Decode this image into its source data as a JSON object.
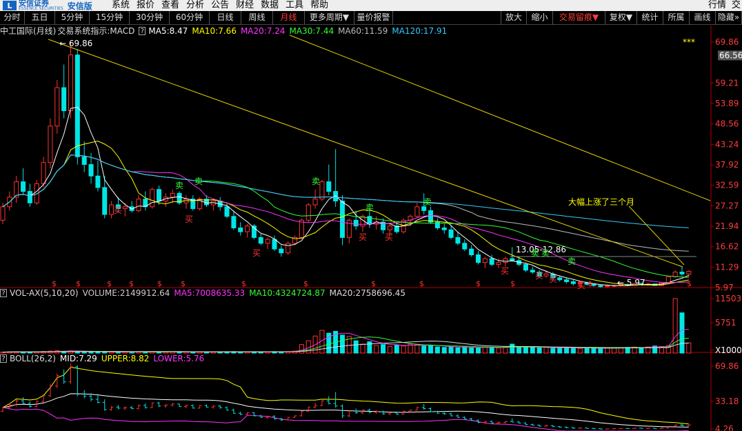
{
  "app": {
    "logo_char": "L",
    "brand_cn": "安信证券",
    "brand_en": "ESSENCE SECURITIES",
    "edition": "安信版",
    "menus": [
      "系统",
      "报价",
      "查看",
      "分析",
      "公告",
      "财经",
      "数据",
      "工具",
      "帮助"
    ],
    "right_menus": [
      "行情",
      "交"
    ]
  },
  "toolbar": {
    "left": [
      "分时",
      "五日",
      "5分钟",
      "15分钟",
      "30分钟",
      "60分钟",
      "日线",
      "周线",
      "月线",
      "更多周期▼",
      "量价报警"
    ],
    "active": "月线",
    "right": [
      "放大",
      "缩小",
      "交易留痕▼",
      "复权▼",
      "统计",
      "所属",
      "画线",
      "隐藏»"
    ],
    "right_active": "交易留痕▼"
  },
  "main_panel": {
    "title": "中工国际(月线)",
    "system": "交易系统指示:MACD",
    "ma": [
      {
        "label": "MA5:8.47",
        "color": "#ffffff"
      },
      {
        "label": "MA10:7.66",
        "color": "#ffff00"
      },
      {
        "label": "MA20:7.24",
        "color": "#ff33ff"
      },
      {
        "label": "MA30:7.44",
        "color": "#33ff33"
      },
      {
        "label": "MA60:11.59",
        "color": "#bbbbbb"
      },
      {
        "label": "MA120:17.91",
        "color": "#33ccff"
      }
    ],
    "y_ticks": [
      "69.86",
      "59.21",
      "53.89",
      "48.56",
      "43.24",
      "37.92",
      "32.59",
      "27.27",
      "21.94",
      "16.62",
      "11.29",
      "5.97"
    ],
    "current_price": "66.56",
    "high_label": "69.86",
    "low_label": "5.97",
    "range_label": "13.05-12.86",
    "annotation": "大幅上涨了三个月",
    "stars": "***",
    "buy_label": "买",
    "sell_label": "卖",
    "dollar_label": "$"
  },
  "volume_panel": {
    "title": "VOL-AX(5,10,20)",
    "volume": {
      "label": "VOLUME:2149912.64",
      "color": "#ffff00"
    },
    "ma": [
      {
        "label": "MA5:7008635.33",
        "color": "#ff33ff"
      },
      {
        "label": "MA10:4324724.87",
        "color": "#33ff33"
      },
      {
        "label": "MA20:2758696.45",
        "color": "#dddddd"
      }
    ],
    "y_ticks": [
      "11503",
      "5751",
      "X1000"
    ]
  },
  "boll_panel": {
    "title": "BOLL(26,2)",
    "items": [
      {
        "label": "MID:7.29",
        "color": "#ffffff"
      },
      {
        "label": "UPPER:8.82",
        "color": "#ffff00"
      },
      {
        "label": "LOWER:5.76",
        "color": "#ff33ff"
      }
    ],
    "y_ticks": [
      "69.86",
      "33.18",
      "4.26"
    ]
  },
  "chart_data": {
    "type": "candlestick",
    "period": "monthly",
    "candles": [
      [
        23.5,
        28.0,
        22.5,
        27.0
      ],
      [
        27.0,
        31.0,
        26.0,
        29.5
      ],
      [
        29.5,
        35.0,
        28.0,
        33.5
      ],
      [
        33.5,
        37.0,
        30.0,
        31.0
      ],
      [
        31.0,
        33.0,
        27.0,
        28.0
      ],
      [
        28.0,
        34.0,
        27.5,
        33.0
      ],
      [
        33.0,
        40.0,
        32.0,
        38.5
      ],
      [
        38.5,
        50.0,
        37.0,
        48.0
      ],
      [
        48.0,
        60.0,
        46.0,
        58.0
      ],
      [
        58.0,
        64.0,
        50.0,
        52.0
      ],
      [
        52.0,
        69.86,
        50.0,
        66.5
      ],
      [
        66.5,
        68.0,
        38.0,
        40.0
      ],
      [
        40.0,
        44.0,
        36.0,
        38.0
      ],
      [
        38.0,
        41.0,
        33.0,
        35.0
      ],
      [
        35.0,
        39.0,
        31.0,
        32.0
      ],
      [
        32.0,
        35.0,
        24.0,
        25.0
      ],
      [
        25.0,
        28.5,
        24.0,
        27.5
      ],
      [
        27.5,
        29.5,
        25.5,
        26.5
      ],
      [
        26.5,
        28.0,
        24.5,
        27.0
      ],
      [
        27.0,
        28.5,
        25.5,
        26.0
      ],
      [
        26.0,
        30.0,
        25.5,
        29.0
      ],
      [
        29.0,
        31.0,
        26.0,
        27.0
      ],
      [
        27.0,
        32.0,
        26.5,
        31.5
      ],
      [
        31.5,
        32.5,
        27.5,
        28.5
      ],
      [
        28.5,
        30.5,
        27.0,
        29.5
      ],
      [
        29.5,
        31.5,
        28.0,
        30.5
      ],
      [
        30.5,
        31.0,
        27.5,
        28.0
      ],
      [
        28.0,
        30.0,
        26.5,
        29.0
      ],
      [
        29.0,
        30.0,
        26.0,
        26.5
      ],
      [
        26.5,
        29.5,
        26.0,
        29.0
      ],
      [
        29.0,
        30.0,
        27.0,
        27.5
      ],
      [
        27.5,
        29.0,
        26.0,
        28.5
      ],
      [
        28.5,
        29.5,
        26.0,
        27.0
      ],
      [
        27.0,
        28.0,
        24.0,
        24.5
      ],
      [
        24.5,
        26.0,
        21.0,
        21.5
      ],
      [
        21.5,
        23.0,
        19.5,
        20.5
      ],
      [
        20.5,
        22.5,
        19.0,
        22.0
      ],
      [
        22.0,
        22.5,
        18.5,
        19.0
      ],
      [
        19.0,
        20.0,
        17.0,
        17.5
      ],
      [
        17.5,
        19.0,
        16.0,
        18.5
      ],
      [
        18.5,
        19.5,
        15.5,
        16.0
      ],
      [
        16.0,
        17.0,
        14.0,
        15.0
      ],
      [
        15.0,
        18.0,
        14.5,
        17.5
      ],
      [
        17.5,
        19.5,
        17.0,
        19.0
      ],
      [
        19.0,
        24.0,
        18.5,
        23.5
      ],
      [
        23.5,
        28.0,
        23.0,
        27.5
      ],
      [
        27.5,
        31.5,
        26.5,
        29.0
      ],
      [
        29.0,
        34.0,
        28.5,
        33.5
      ],
      [
        33.5,
        38.0,
        30.0,
        31.0
      ],
      [
        31.0,
        42.0,
        27.0,
        28.5
      ],
      [
        28.5,
        30.0,
        17.0,
        19.0
      ],
      [
        19.0,
        24.0,
        17.5,
        23.5
      ],
      [
        23.5,
        26.0,
        21.0,
        22.0
      ],
      [
        22.0,
        25.0,
        20.5,
        24.5
      ],
      [
        24.5,
        26.0,
        21.5,
        22.5
      ],
      [
        22.5,
        24.5,
        21.0,
        23.0
      ],
      [
        23.0,
        24.0,
        20.0,
        21.0
      ],
      [
        21.0,
        22.5,
        19.5,
        22.0
      ],
      [
        22.0,
        23.0,
        20.0,
        20.5
      ],
      [
        20.5,
        24.0,
        20.0,
        23.5
      ],
      [
        23.5,
        25.0,
        22.0,
        24.5
      ],
      [
        24.5,
        28.0,
        24.0,
        27.0
      ],
      [
        27.0,
        30.5,
        25.0,
        26.0
      ],
      [
        26.0,
        27.0,
        22.5,
        23.0
      ],
      [
        23.0,
        24.0,
        21.0,
        21.5
      ],
      [
        21.5,
        22.5,
        20.0,
        21.0
      ],
      [
        21.0,
        22.0,
        18.5,
        19.0
      ],
      [
        19.0,
        20.5,
        17.0,
        17.5
      ],
      [
        17.5,
        18.5,
        15.5,
        16.0
      ],
      [
        16.0,
        17.0,
        14.0,
        14.5
      ],
      [
        14.5,
        15.5,
        12.0,
        12.5
      ],
      [
        12.5,
        14.0,
        11.0,
        13.5
      ],
      [
        13.5,
        14.5,
        11.5,
        12.0
      ],
      [
        12.0,
        13.5,
        11.0,
        12.5
      ],
      [
        12.5,
        14.0,
        11.5,
        13.5
      ],
      [
        13.5,
        16.5,
        13.0,
        13.0
      ],
      [
        13.0,
        14.0,
        11.5,
        12.0
      ],
      [
        12.0,
        12.5,
        10.0,
        10.5
      ],
      [
        10.5,
        11.5,
        9.5,
        10.0
      ],
      [
        10.0,
        10.5,
        8.5,
        9.0
      ],
      [
        9.0,
        10.5,
        8.5,
        9.5
      ],
      [
        9.5,
        10.0,
        8.0,
        8.5
      ],
      [
        8.5,
        9.0,
        7.5,
        8.0
      ],
      [
        8.0,
        8.5,
        7.0,
        7.5
      ],
      [
        7.5,
        8.0,
        6.5,
        7.0
      ],
      [
        7.0,
        7.5,
        6.5,
        7.2
      ],
      [
        7.2,
        7.5,
        6.5,
        6.8
      ],
      [
        6.8,
        7.0,
        6.2,
        6.5
      ],
      [
        6.5,
        6.8,
        5.97,
        6.2
      ],
      [
        6.2,
        6.6,
        6.0,
        6.4
      ],
      [
        6.4,
        6.8,
        6.1,
        6.5
      ],
      [
        6.5,
        6.9,
        6.3,
        6.7
      ],
      [
        6.7,
        7.0,
        6.4,
        6.6
      ],
      [
        6.6,
        7.2,
        6.4,
        7.0
      ],
      [
        7.0,
        7.3,
        6.6,
        6.8
      ],
      [
        6.8,
        7.1,
        6.5,
        6.9
      ],
      [
        6.9,
        7.0,
        6.4,
        6.5
      ],
      [
        6.5,
        7.4,
        6.4,
        7.2
      ],
      [
        7.2,
        9.0,
        7.0,
        8.8
      ],
      [
        8.8,
        10.5,
        8.5,
        10.0
      ],
      [
        10.0,
        11.5,
        9.0,
        9.5
      ],
      [
        9.5,
        10.5,
        8.7,
        10.2
      ]
    ],
    "volume_thousands": [
      200,
      260,
      300,
      240,
      220,
      270,
      350,
      420,
      500,
      380,
      480,
      400,
      340,
      300,
      260,
      280,
      250,
      240,
      260,
      230,
      300,
      280,
      320,
      260,
      270,
      300,
      250,
      280,
      260,
      300,
      270,
      260,
      280,
      300,
      320,
      280,
      260,
      300,
      280,
      290,
      310,
      300,
      330,
      420,
      1800,
      2600,
      3600,
      4800,
      4200,
      4600,
      3800,
      3500,
      2600,
      1900,
      2400,
      1600,
      1800,
      1400,
      1700,
      1500,
      1900,
      1800,
      1500,
      1600,
      1300,
      1200,
      1250,
      1100,
      1300,
      1200,
      1050,
      1300,
      1150,
      1100,
      1300,
      1900,
      1200,
      1350,
      1200,
      1100,
      1200,
      1000,
      1200,
      1150,
      1100,
      1000,
      1050,
      950,
      1000,
      1100,
      1050,
      1150,
      1200,
      1250,
      1100,
      1300,
      1500,
      1400,
      1600,
      11503,
      8500,
      2150
    ],
    "ylim": [
      5.97,
      69.86
    ],
    "volume_ylim": [
      0,
      11503
    ]
  }
}
